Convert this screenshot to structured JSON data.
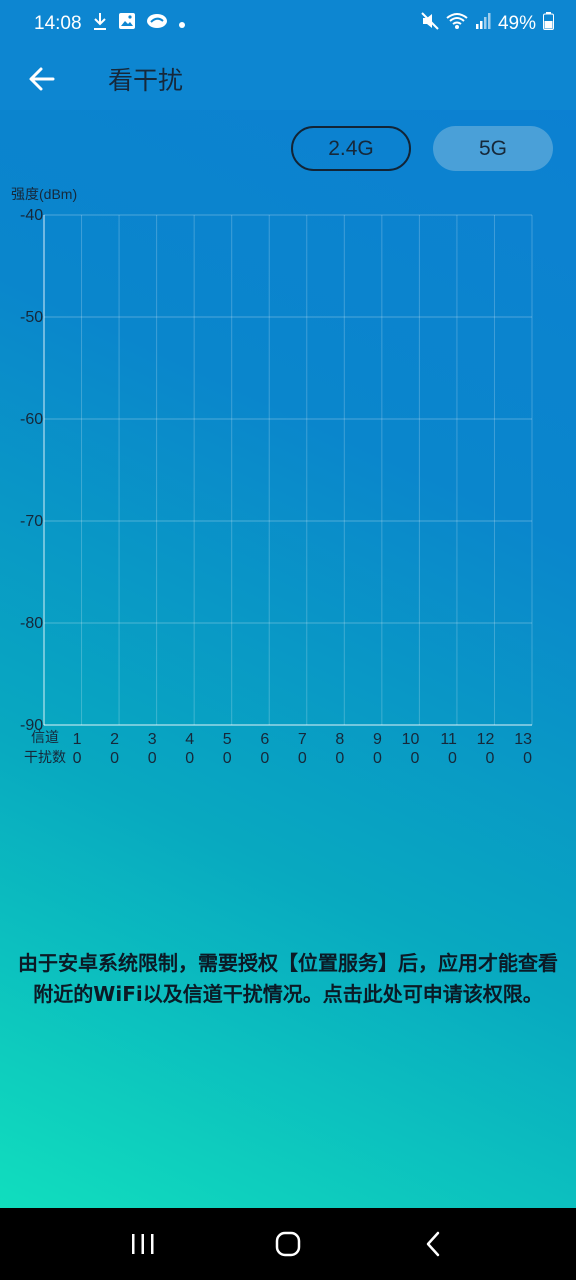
{
  "status_bar": {
    "time": "14:08",
    "battery": "49%",
    "icons": [
      "download-icon",
      "image-icon",
      "cloud-icon",
      "dot-icon",
      "mute-icon",
      "wifi-icon",
      "signal-icon",
      "battery-icon"
    ]
  },
  "app_bar": {
    "title": "看干扰",
    "back_icon": "arrow-left-icon"
  },
  "bands": {
    "b24_label": "2.4G",
    "b5_label": "5G"
  },
  "chart_data": {
    "type": "bar",
    "ylabel": "强度(dBm)",
    "ylim": [
      -90,
      -40
    ],
    "yticks": [
      -40,
      -50,
      -60,
      -70,
      -80,
      -90
    ],
    "grid": true,
    "row_labels": [
      "信道",
      "干扰数"
    ],
    "channels": [
      "1",
      "2",
      "3",
      "4",
      "5",
      "6",
      "7",
      "8",
      "9",
      "10",
      "11",
      "12",
      "13"
    ],
    "interference_counts": [
      0,
      0,
      0,
      0,
      0,
      0,
      0,
      0,
      0,
      0,
      0,
      0,
      0
    ]
  },
  "notice": {
    "text": "由于安卓系统限制，需要授权【位置服务】后，应用才能查看附近的WiFi以及信道干扰情况。点击此处可申请该权限。"
  },
  "nav_bar": {
    "icons": [
      "recent-apps-icon",
      "home-icon",
      "back-icon"
    ]
  },
  "colors": {
    "status_bar": "#0d86d1",
    "gradient_top": "#0d7fd3",
    "gradient_bottom": "#12e6bd",
    "band_5g_bg": "#4aa0d8",
    "text_dark": "#16283a"
  }
}
